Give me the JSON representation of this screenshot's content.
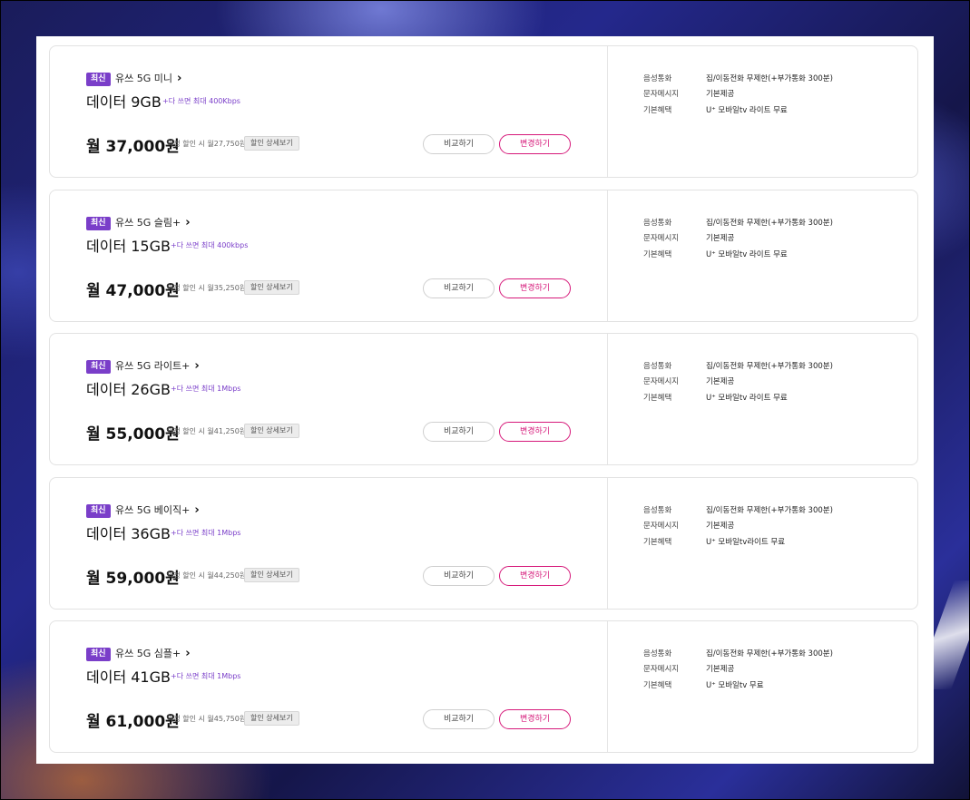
{
  "plans": [
    {
      "badge": "최신",
      "name": "유쓰 5G 미니",
      "data": "데이터 9GB",
      "data_note": "+다 쓰면 최대 400Kbps",
      "price": "월 37,000원",
      "discount": "약정 할인 시 월27,750원",
      "detail_label": "할인 상세보기",
      "compare_label": "비교하기",
      "change_label": "변경하기",
      "specs": [
        {
          "key": "음성통화",
          "value": "집/이동전화 무제한(+부가통화 300분)"
        },
        {
          "key": "문자메시지",
          "value": "기본제공"
        },
        {
          "key": "기본혜택",
          "value": "U⁺ 모바일tv 라이트 무료"
        }
      ]
    },
    {
      "badge": "최신",
      "name": "유쓰 5G 슬림+",
      "data": "데이터 15GB",
      "data_note": "+다 쓰면 최대 400kbps",
      "price": "월 47,000원",
      "discount": "약정 할인 시 월35,250원",
      "detail_label": "할인 상세보기",
      "compare_label": "비교하기",
      "change_label": "변경하기",
      "specs": [
        {
          "key": "음성통화",
          "value": "집/이동전화 무제한(+부가통화 300분)"
        },
        {
          "key": "문자메시지",
          "value": "기본제공"
        },
        {
          "key": "기본혜택",
          "value": "U⁺ 모바일tv 라이트 무료"
        }
      ]
    },
    {
      "badge": "최신",
      "name": "유쓰 5G 라이트+",
      "data": "데이터 26GB",
      "data_note": "+다 쓰면 최대 1Mbps",
      "price": "월 55,000원",
      "discount": "약정 할인 시 월41,250원",
      "detail_label": "할인 상세보기",
      "compare_label": "비교하기",
      "change_label": "변경하기",
      "specs": [
        {
          "key": "음성통화",
          "value": "집/이동전화 무제한(+부가통화 300분)"
        },
        {
          "key": "문자메시지",
          "value": "기본제공"
        },
        {
          "key": "기본혜택",
          "value": "U⁺ 모바일tv 라이트 무료"
        }
      ]
    },
    {
      "badge": "최신",
      "name": "유쓰 5G 베이직+",
      "data": "데이터 36GB",
      "data_note": "+다 쓰면 최대 1Mbps",
      "price": "월 59,000원",
      "discount": "약정 할인 시 월44,250원",
      "detail_label": "할인 상세보기",
      "compare_label": "비교하기",
      "change_label": "변경하기",
      "specs": [
        {
          "key": "음성통화",
          "value": "집/이동전화 무제한(+부가통화 300분)"
        },
        {
          "key": "문자메시지",
          "value": "기본제공"
        },
        {
          "key": "기본혜택",
          "value": "U⁺ 모바일tv라이트 무료"
        }
      ]
    },
    {
      "badge": "최신",
      "name": "유쓰 5G 심플+",
      "data": "데이터 41GB",
      "data_note": "+다 쓰면 최대 1Mbps",
      "price": "월 61,000원",
      "discount": "약정 할인 시 월45,750원",
      "detail_label": "할인 상세보기",
      "compare_label": "비교하기",
      "change_label": "변경하기",
      "specs": [
        {
          "key": "음성통화",
          "value": "집/이동전화 무제한(+부가통화 300분)"
        },
        {
          "key": "문자메시지",
          "value": "기본제공"
        },
        {
          "key": "기본혜택",
          "value": "U⁺ 모바일tv 무료"
        }
      ]
    }
  ],
  "colors": {
    "badge": "#7a3ec9",
    "accent": "#d6197a",
    "note": "#7a3ec9"
  }
}
